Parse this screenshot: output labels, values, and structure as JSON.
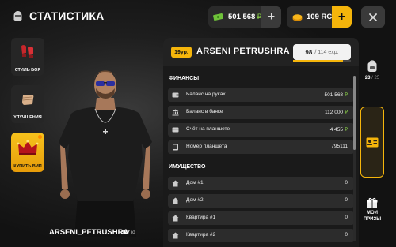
{
  "header": {
    "title": "СТАТИСТИКА",
    "cash": "501 568",
    "cash_currency": "₽",
    "plus": "+",
    "rc": "109 RC",
    "close": "✕"
  },
  "left_menu": [
    {
      "label": "СТИЛЬ БОЯ",
      "icon": "boxing-gloves-icon"
    },
    {
      "label": "УЛУЧШЕНИЯ",
      "icon": "fist-icon"
    },
    {
      "label": "КУПИТЬ ВИП",
      "icon": "crown-icon"
    }
  ],
  "character": {
    "name": "ARSENI_PETRUSHRA",
    "id_value": "327",
    "id_label": "id"
  },
  "panel": {
    "level": "19ур.",
    "player_name": "ARSENI PETRUSHRA",
    "exp_current": "98",
    "exp_total": "/ 114 exp.",
    "exp_fraction": 0.86,
    "finances_title": "ФИНАНСЫ",
    "finances": [
      {
        "label": "Баланс на руках",
        "value": "501 568",
        "currency": "₽",
        "icon": "wallet-icon"
      },
      {
        "label": "Баланс в банке",
        "value": "112 000",
        "currency": "₽",
        "icon": "bank-icon"
      },
      {
        "label": "Счёт на планшете",
        "value": "4 455",
        "currency": "₽",
        "icon": "card-icon"
      },
      {
        "label": "Номер планшета",
        "value": "795111",
        "currency": "",
        "icon": "tablet-icon"
      }
    ],
    "property_title": "ИМУЩЕСТВО",
    "property": [
      {
        "label": "Дом #1",
        "value": "0",
        "icon": "house-icon"
      },
      {
        "label": "Дом #2",
        "value": "0",
        "icon": "house-icon"
      },
      {
        "label": "Квартира #1",
        "value": "0",
        "icon": "house-icon"
      },
      {
        "label": "Квартира #2",
        "value": "0",
        "icon": "house-icon"
      }
    ]
  },
  "right_menu": {
    "backpack_count": "23",
    "backpack_total": "/ 25",
    "prizes_line1": "МОИ",
    "prizes_line2": "ПРИЗЫ"
  },
  "colors": {
    "accent": "#f5b50b",
    "money": "#8bd448",
    "panel": "#1a1a1a",
    "row": "#2c2c2c"
  }
}
